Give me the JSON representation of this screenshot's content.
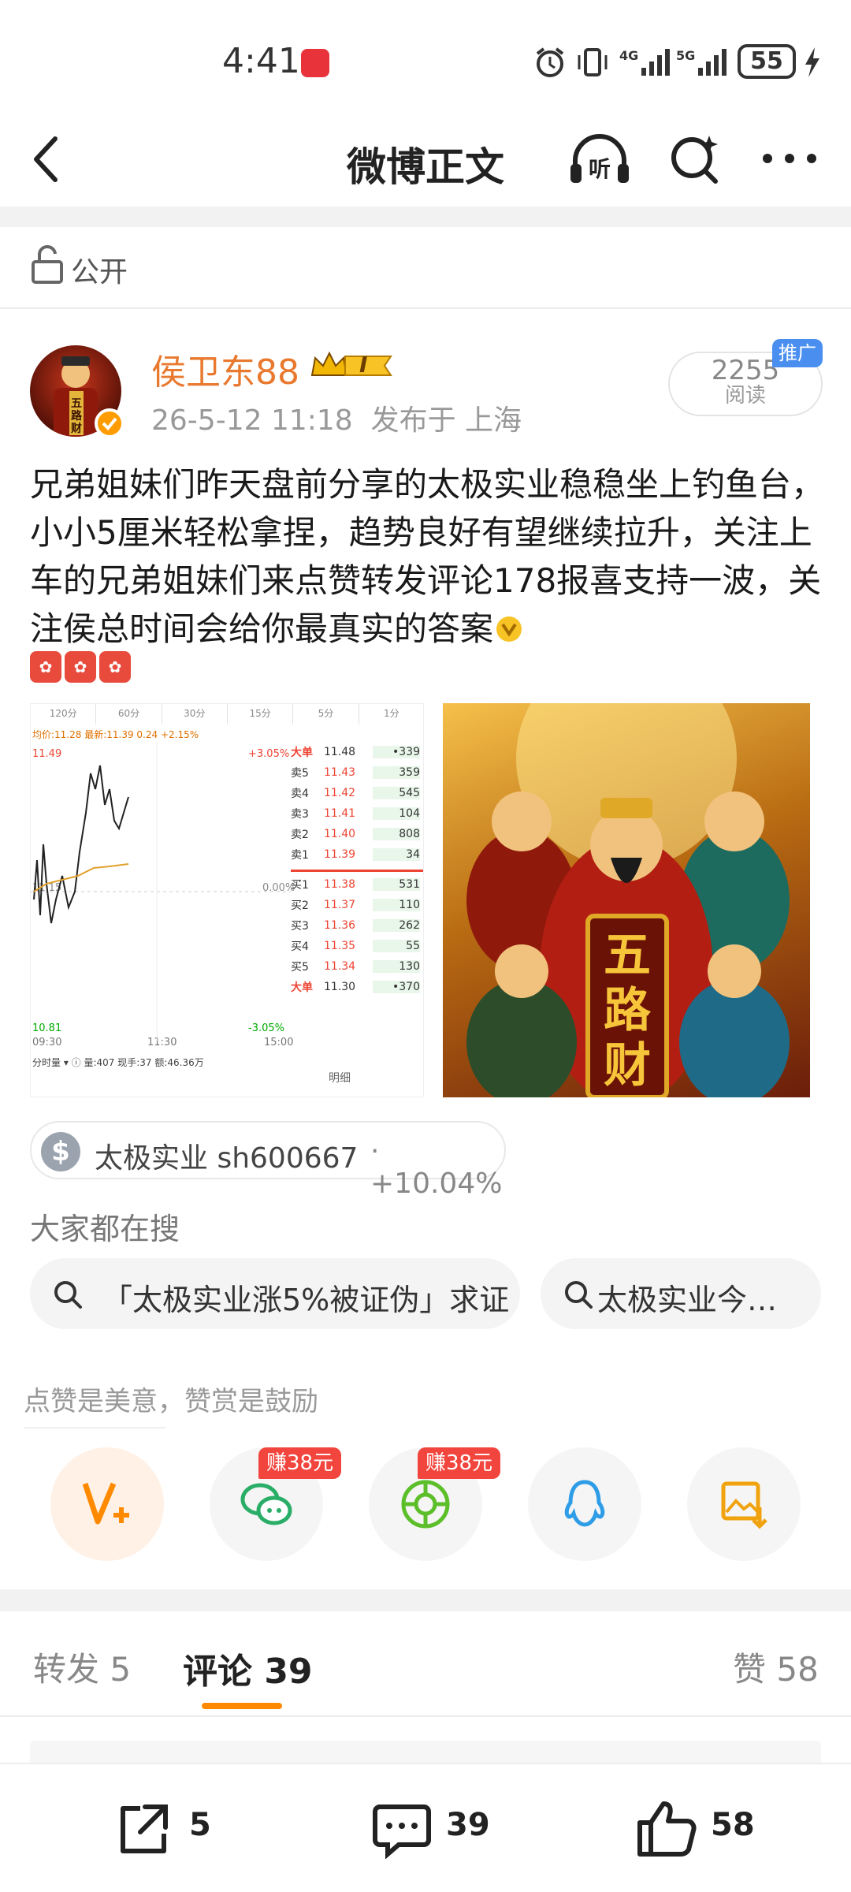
{
  "status_bar": {
    "time": "4:41",
    "battery": "55"
  },
  "nav": {
    "title": "微博正文"
  },
  "visibility": {
    "label": "公开"
  },
  "author": {
    "name": "侯卫东88",
    "level": "I",
    "date": "26-5-12 11:18",
    "location": "发布于 上海",
    "avatar_text": "五路财神"
  },
  "reads": {
    "count": "2255",
    "label": "阅读",
    "promo_badge": "推广"
  },
  "post": {
    "text": "兄弟姐妹们昨天盘前分享的太极实业稳稳坐上钓鱼台，小小5厘米轻松拿捏，趋势良好有望继续拉升，关注上车的兄弟姐妹们来点赞转发评论178报喜支持一波，关注侯总时间会给你最真实的答案"
  },
  "chart_image": {
    "tabs": [
      "120分",
      "60分",
      "30分",
      "15分",
      "5分",
      "1分"
    ],
    "avg_line": "均价:11.28 最新:11.39 0.24 +2.15%",
    "high": "11.49",
    "mid": "11.15",
    "low": "10.81",
    "pct_high": "+3.05%",
    "pct_mid": "0.00%",
    "pct_low": "-3.05%",
    "t_start": "09:30",
    "t_mid": "11:30",
    "t_end": "15:00",
    "footer": "分时量 ▾ ⓘ 量:407 现手:37 额:46.36万",
    "detail": "明细",
    "big_top": {
      "label": "大单",
      "price": "11.48",
      "vol": "•339"
    },
    "big_bottom": {
      "label": "大单",
      "price": "11.30",
      "vol": "•370"
    },
    "sell": [
      {
        "label": "卖5",
        "price": "11.43",
        "vol": "359"
      },
      {
        "label": "卖4",
        "price": "11.42",
        "vol": "545"
      },
      {
        "label": "卖3",
        "price": "11.41",
        "vol": "104"
      },
      {
        "label": "卖2",
        "price": "11.40",
        "vol": "808"
      },
      {
        "label": "卖1",
        "price": "11.39",
        "vol": "34"
      }
    ],
    "buy": [
      {
        "label": "买1",
        "price": "11.38",
        "vol": "531"
      },
      {
        "label": "买2",
        "price": "11.37",
        "vol": "110"
      },
      {
        "label": "买3",
        "price": "11.36",
        "vol": "262"
      },
      {
        "label": "买4",
        "price": "11.35",
        "vol": "55"
      },
      {
        "label": "买5",
        "price": "11.34",
        "vol": "130"
      }
    ]
  },
  "poster_image": {
    "text1": "五",
    "text2": "路",
    "text3": "财"
  },
  "stock_tag": {
    "name": "太极实业 sh600667",
    "change": "· +10.04%"
  },
  "search": {
    "title": "大家都在搜",
    "items": [
      "「太极实业涨5%被证伪」求证",
      "太极实业今…"
    ]
  },
  "reward": {
    "text": "点赞是美意，赞赏是鼓励",
    "earn_badge_1": "赚38元",
    "earn_badge_2": "赚38元"
  },
  "tabs": {
    "repost": "转发 5",
    "comment": "评论 39",
    "like": "赞 58"
  },
  "bottom_bar": {
    "repost_count": "5",
    "comment_count": "39",
    "like_count": "58"
  },
  "colors": {
    "accent": "#ff8a00",
    "username": "#e8792e",
    "red": "#f2453d",
    "blue": "#4a8ff0"
  }
}
